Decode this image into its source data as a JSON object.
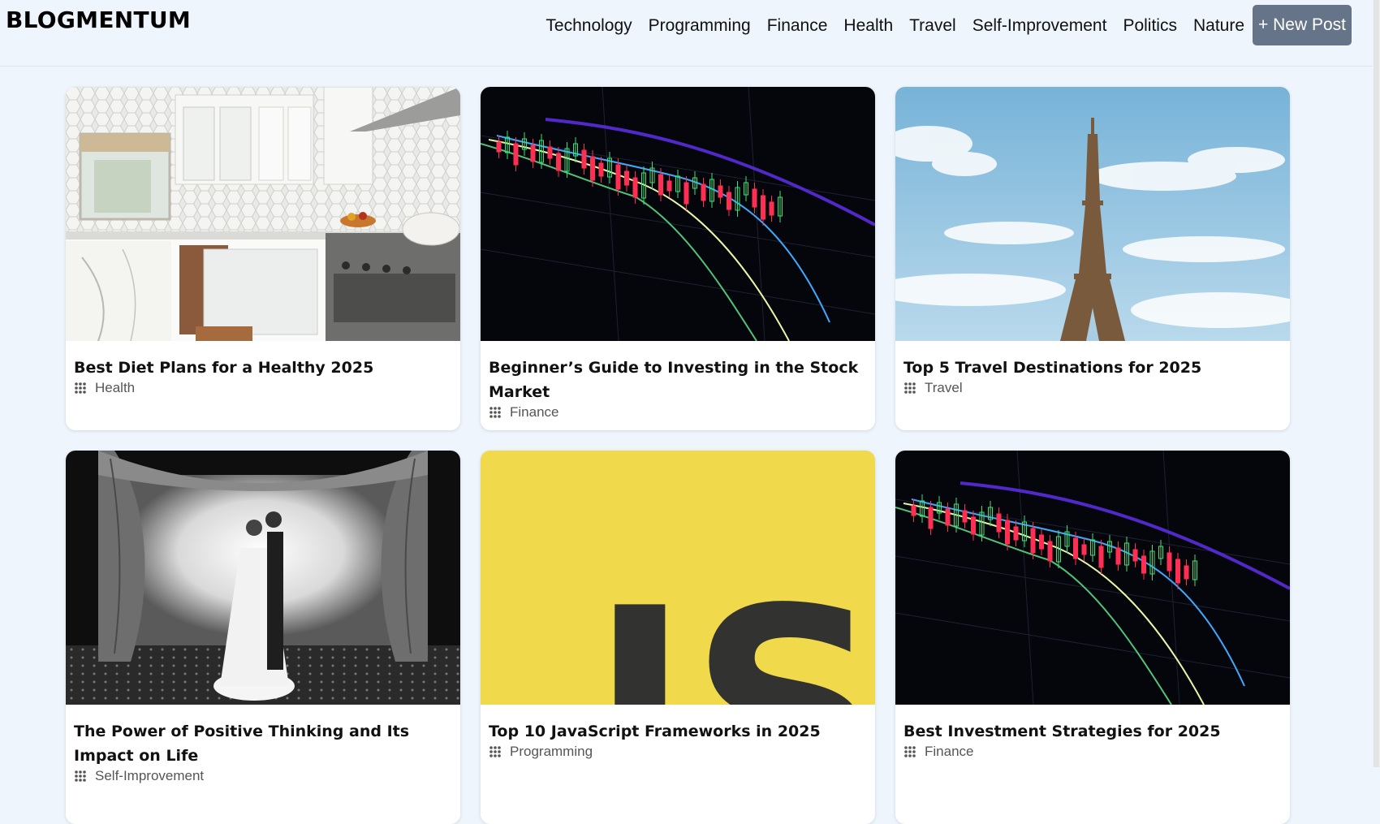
{
  "header": {
    "logo": "BLOGMENTUM",
    "nav": [
      "Technology",
      "Programming",
      "Finance",
      "Health",
      "Travel",
      "Self-Improvement",
      "Politics",
      "Nature"
    ],
    "new_post_label": "+ New Post"
  },
  "posts": [
    {
      "title": "Best Diet Plans for a Healthy 2025",
      "category": "Health",
      "image": "kitchen"
    },
    {
      "title": "Beginner’s Guide to Investing in the Stock Market",
      "category": "Finance",
      "image": "stock-chart"
    },
    {
      "title": "Top 5 Travel Destinations for 2025",
      "category": "Travel",
      "image": "eiffel-tower"
    },
    {
      "title": "The Power of Positive Thinking and Its Impact on Life",
      "category": "Self-Improvement",
      "image": "wedding-couple"
    },
    {
      "title": "Top 10 JavaScript Frameworks in 2025",
      "category": "Programming",
      "image": "js-logo"
    },
    {
      "title": "Best Investment Strategies for 2025",
      "category": "Finance",
      "image": "stock-chart"
    }
  ],
  "category_icon": "grid-dots-icon",
  "thumb_text": {
    "js_logo": "JS"
  }
}
